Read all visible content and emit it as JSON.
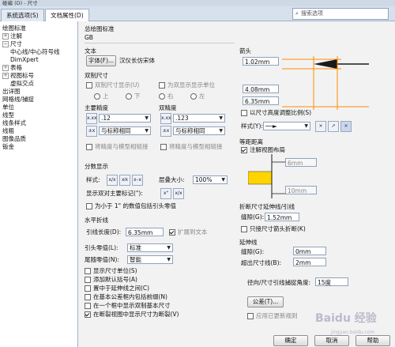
{
  "window": {
    "title": "碰编 (D) - 尺寸"
  },
  "tabs": [
    {
      "label": "系统选项(S)"
    },
    {
      "label": "文档属性(D)"
    }
  ],
  "search": {
    "placeholder": "搜索选项"
  },
  "sidebar": {
    "items": [
      {
        "label": "绘图标准"
      },
      {
        "label": "注解"
      },
      {
        "label": "尺寸"
      },
      {
        "label": "中心线/中心符号线"
      },
      {
        "label": "DimXpert"
      },
      {
        "label": "表格"
      },
      {
        "label": "视图标号"
      },
      {
        "label": "虚拟交点"
      },
      {
        "label": "出详图"
      },
      {
        "label": "网格线/捕捉"
      },
      {
        "label": "单位"
      },
      {
        "label": "线型"
      },
      {
        "label": "线条样式"
      },
      {
        "label": "线粗"
      },
      {
        "label": "图像品质"
      },
      {
        "label": "钣金"
      }
    ]
  },
  "general": {
    "section_label": "总绘图标准",
    "value": "GB"
  },
  "text": {
    "section_label": "文本",
    "font_button": "字体(F)...",
    "font_name": "汉仪长仿宋体"
  },
  "dual": {
    "section_label": "双制尺寸",
    "dual_checkbox": "双制尺寸显示(U)",
    "dual_units_checkbox": "为双显示显示单位",
    "radios": [
      "上",
      "下",
      "右",
      "左"
    ]
  },
  "precision": {
    "primary_label": "主要精度",
    "primary_value": ".12",
    "primary_tol": "与标称相同",
    "primary_link": "将精度与模型相链接",
    "dual_label": "双精度",
    "dual_value": ".123",
    "dual_tol": "与标称相同",
    "dual_link": "将精度与模型相链接"
  },
  "fraction": {
    "section_label": "分数显示",
    "style_label": "样式:",
    "stack_label": "层叠大小:",
    "stack_value": "100%",
    "double_prime_label": "显示双对主要标记(\"):",
    "zero_label": "为小于 1\" 的数值包括引头零值"
  },
  "horiz": {
    "section_label": "水平折线",
    "leader_length_label": "引线长度(D):",
    "leader_length_value": "6.35mm",
    "extend_text": "扩展到文本"
  },
  "zeros": {
    "leading_label": "引头零值(L):",
    "leading_value": "标准",
    "trailing_label": "尾随零值(N):",
    "trailing_value": "智能"
  },
  "checks": [
    {
      "label": "显示尺寸单位(S)",
      "checked": false
    },
    {
      "label": "添加默认括号(A)",
      "checked": false
    },
    {
      "label": "置中于延伸线之间(C)",
      "checked": false
    },
    {
      "label": "在基本公差框内包括前缀(N)",
      "checked": false
    },
    {
      "label": "在一个框中显示双制基本尺寸",
      "checked": false
    },
    {
      "label": "在断裂视图中显示尺寸为断裂(V)",
      "checked": true
    }
  ],
  "arrows": {
    "section_label": "箭头",
    "v1": "1.02mm",
    "v2": "4.08mm",
    "v3": "6.35mm",
    "scale_checkbox": "以尺寸高度调整比例(S)",
    "style_label": "样式(Y):"
  },
  "offset": {
    "section_label": "等距距离",
    "layout_checkbox": "注解视图布局",
    "val1": "6mm",
    "val2": "10mm"
  },
  "break": {
    "section_label": "折断尺寸延伸线/引线",
    "gap_label": "缝隙(G):",
    "gap_value": "1.52mm",
    "only_arrow": "只接尺寸箭头折断(K)"
  },
  "extension": {
    "section_label": "延伸线",
    "gap_label": "缝隙(G):",
    "gap_value": "0mm",
    "beyond_label": "超出尺寸线(B):",
    "beyond_value": "2mm"
  },
  "radial": {
    "label": "径向/尺寸引线捕捉角度:",
    "value": "15度"
  },
  "tolerance": {
    "button": "公差(T)..."
  },
  "apply_new": {
    "label": "应用已更新规则"
  },
  "footer": {
    "ok": "确定",
    "cancel": "取消",
    "help": "帮助"
  },
  "watermark": {
    "text": "Baidu 经验",
    "sub": "jingyan.baidu.com"
  }
}
